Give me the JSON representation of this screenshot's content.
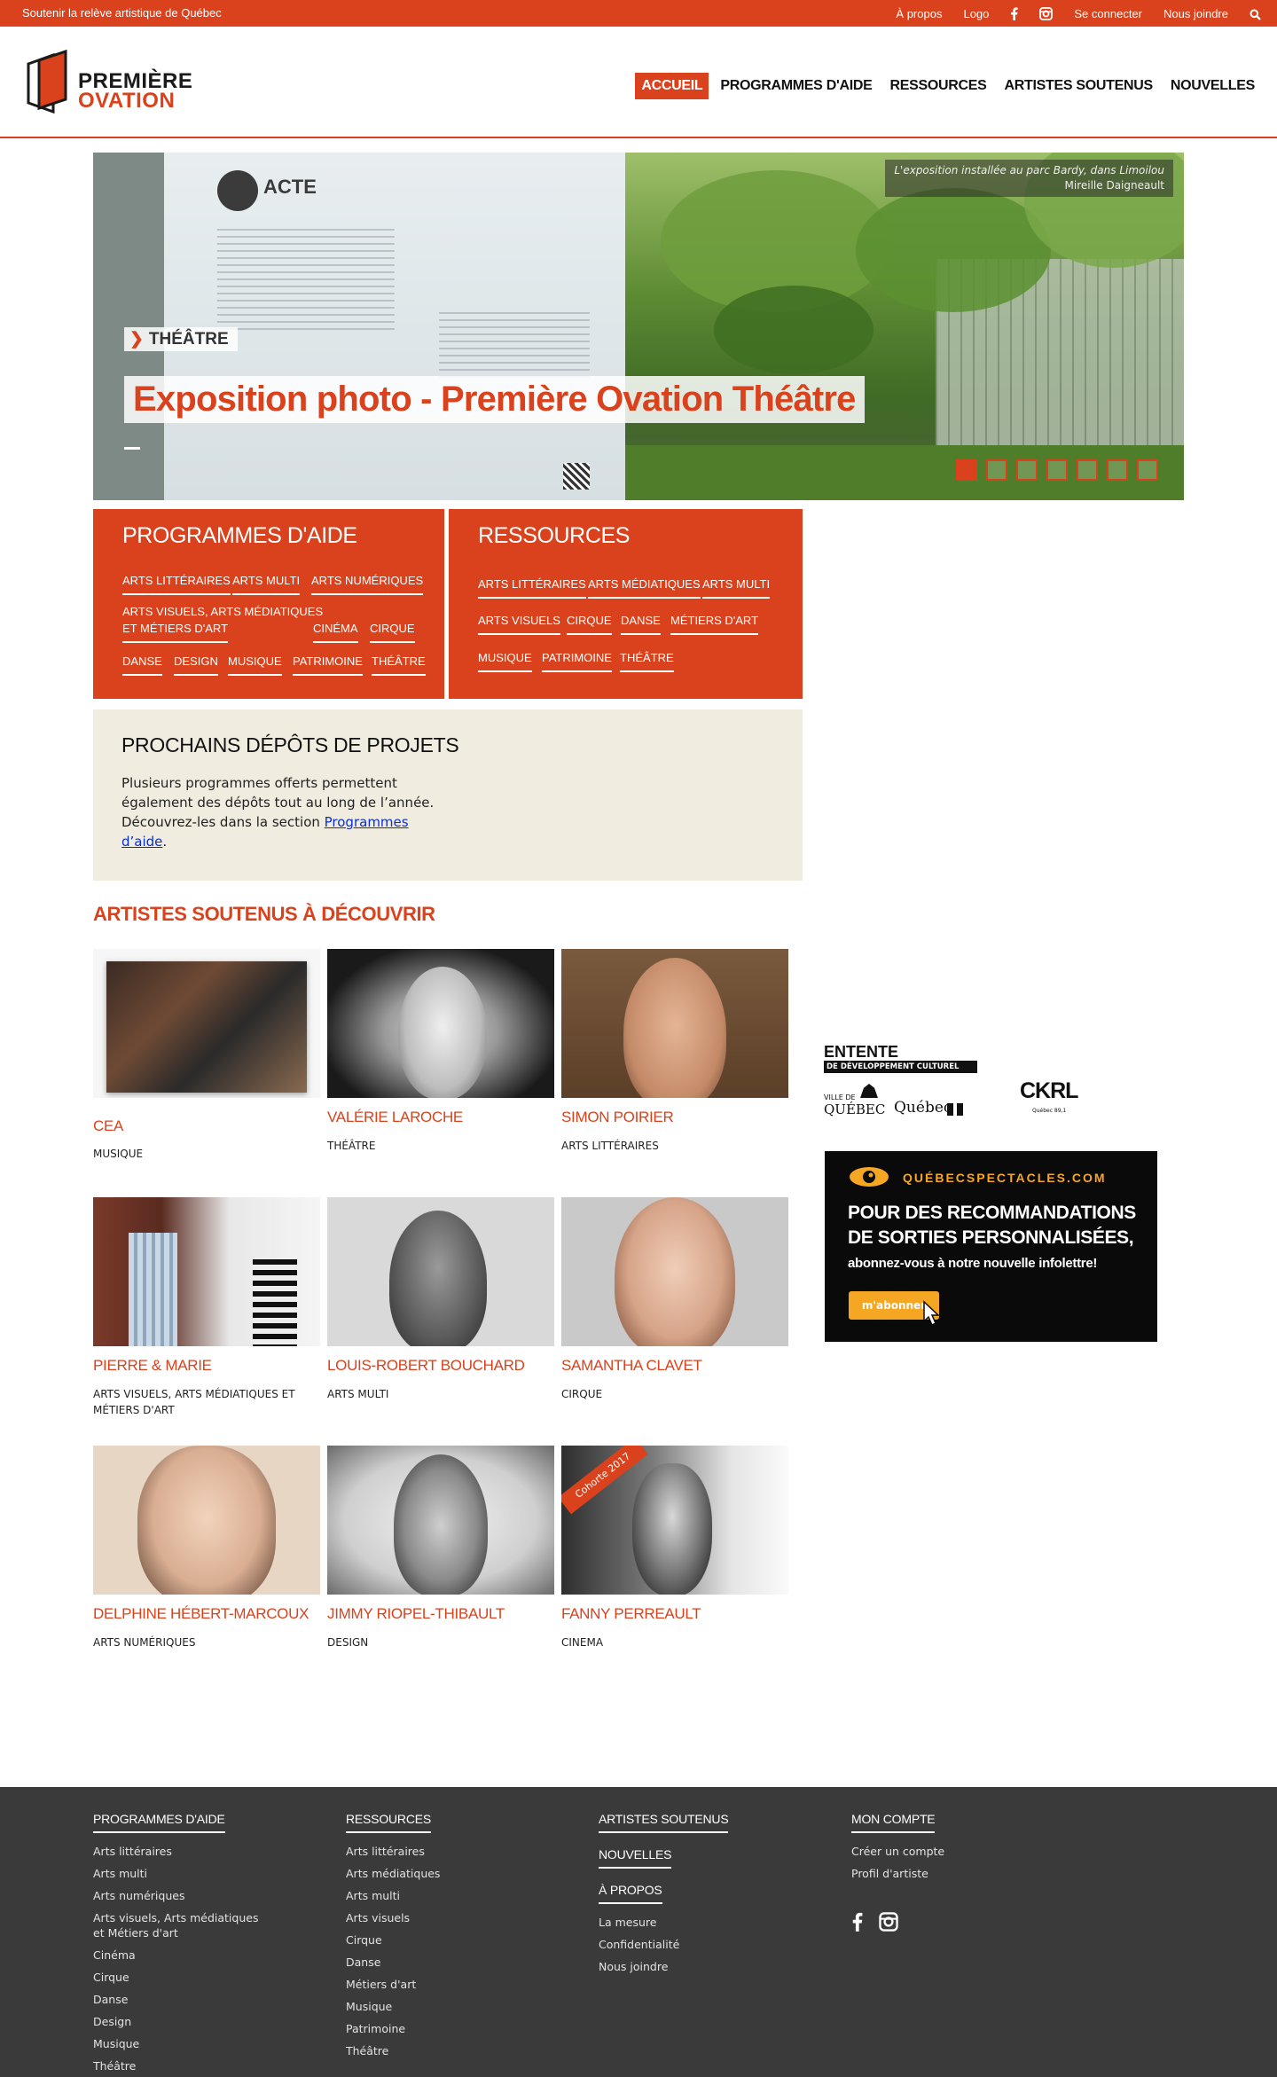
{
  "topbar": {
    "tagline": "Soutenir la relève artistique de Québec",
    "links": [
      "À propos",
      "Logo",
      "Se connecter",
      "Nous joindre"
    ]
  },
  "header": {
    "logo_line1": "PREMIÈRE",
    "logo_line2": "OVATION",
    "nav": [
      "ACCUEIL",
      "PROGRAMMES D'AIDE",
      "RESSOURCES",
      "ARTISTES SOUTENUS",
      "NOUVELLES"
    ],
    "active_nav": "ACCUEIL"
  },
  "hero": {
    "caption_line1": "L'exposition installée au parc Bardy, dans Limoilou",
    "caption_line2": "Mireille Daigneault",
    "category": "THÉÂTRE",
    "title": "Exposition photo - Première Ovation Théâtre",
    "slide_count": 7,
    "active_slide": 1
  },
  "programmes": {
    "title": "PROGRAMMES D'AIDE",
    "tags": [
      "ARTS LITTÉRAIRES",
      "ARTS MULTI",
      "ARTS NUMÉRIQUES",
      "ARTS VISUELS, ARTS MÉDIATIQUES",
      "ET MÉTIERS D'ART",
      "CINÉMA",
      "CIRQUE",
      "DANSE",
      "DESIGN",
      "MUSIQUE",
      "PATRIMOINE",
      "THÉÂTRE"
    ]
  },
  "ressources": {
    "title": "RESSOURCES",
    "tags": [
      "ARTS LITTÉRAIRES",
      "ARTS MÉDIATIQUES",
      "ARTS MULTI",
      "ARTS VISUELS",
      "CIRQUE",
      "DANSE",
      "MÉTIERS D'ART",
      "MUSIQUE",
      "PATRIMOINE",
      "THÉÂTRE"
    ]
  },
  "depots": {
    "title": "PROCHAINS DÉPÔTS DE PROJETS",
    "text": "Plusieurs programmes offerts permettent également des dépôts tout au long de l’année. Découvrez-les dans la section ",
    "link": "Programmes d’aide",
    "end": "."
  },
  "artists_title": "ARTISTES SOUTENUS À DÉCOUVRIR",
  "artists": [
    {
      "name": "CEA",
      "discipline": "MUSIQUE"
    },
    {
      "name": "VALÉRIE LAROCHE",
      "discipline": "THÉÂTRE"
    },
    {
      "name": "SIMON POIRIER",
      "discipline": "ARTS LITTÉRAIRES"
    },
    {
      "name": "PIERRE & MARIE",
      "discipline": "ARTS VISUELS, ARTS MÉDIATIQUES ET MÉTIERS D'ART"
    },
    {
      "name": "LOUIS-ROBERT BOUCHARD",
      "discipline": "ARTS MULTI"
    },
    {
      "name": "SAMANTHA CLAVET",
      "discipline": "CIRQUE"
    },
    {
      "name": "DELPHINE HÉBERT-MARCOUX",
      "discipline": "ARTS NUMÉRIQUES"
    },
    {
      "name": "JIMMY RIOPEL-THIBAULT",
      "discipline": "DESIGN"
    },
    {
      "name": "FANNY PERREAULT",
      "discipline": "CINEMA"
    }
  ],
  "fanny_badge": "Cohorte 2017",
  "sidebar": {
    "entente_title": "ENTENTE",
    "entente_sub": "DE DÉVELOPPEMENT CULTUREL",
    "ville_small": "VILLE DE",
    "ville_big": "QUÉBEC",
    "quebec": "Québec",
    "ckrl": "CKRL",
    "ckrl_sub": "Québec 89,1",
    "ad_brand": "QUÉBECSPECTACLES.COM",
    "ad_line1": "POUR DES RECOMMANDATIONS",
    "ad_line2": "DE SORTIES PERSONNALISÉES,",
    "ad_line3": "abonnez-vous à notre nouvelle infolettre!",
    "ad_button": "m'abonner"
  },
  "footer": {
    "col1": {
      "title": "PROGRAMMES D'AIDE",
      "links": [
        "Arts littéraires",
        "Arts multi",
        "Arts numériques",
        "Arts visuels, Arts médiatiques",
        "et Métiers d'art",
        "Cinéma",
        "Cirque",
        "Danse",
        "Design",
        "Musique",
        "Théâtre"
      ]
    },
    "col2": {
      "title": "RESSOURCES",
      "links": [
        "Arts littéraires",
        "Arts médiatiques",
        "Arts multi",
        "Arts visuels",
        "Cirque",
        "Danse",
        "Métiers d'art",
        "Musique",
        "Patrimoine",
        "Théâtre"
      ]
    },
    "col3": {
      "title1": "ARTISTES SOUTENUS",
      "title2": "NOUVELLES",
      "title3": "À PROPOS",
      "links": [
        "La mesure",
        "Confidentialité",
        "Nous joindre"
      ]
    },
    "col4": {
      "title": "MON COMPTE",
      "links": [
        "Créer un compte",
        "Profil d'artiste"
      ]
    }
  },
  "colors": {
    "accent": "#d9421c",
    "beige": "#f1ece0",
    "footer": "#3a3a3a"
  }
}
